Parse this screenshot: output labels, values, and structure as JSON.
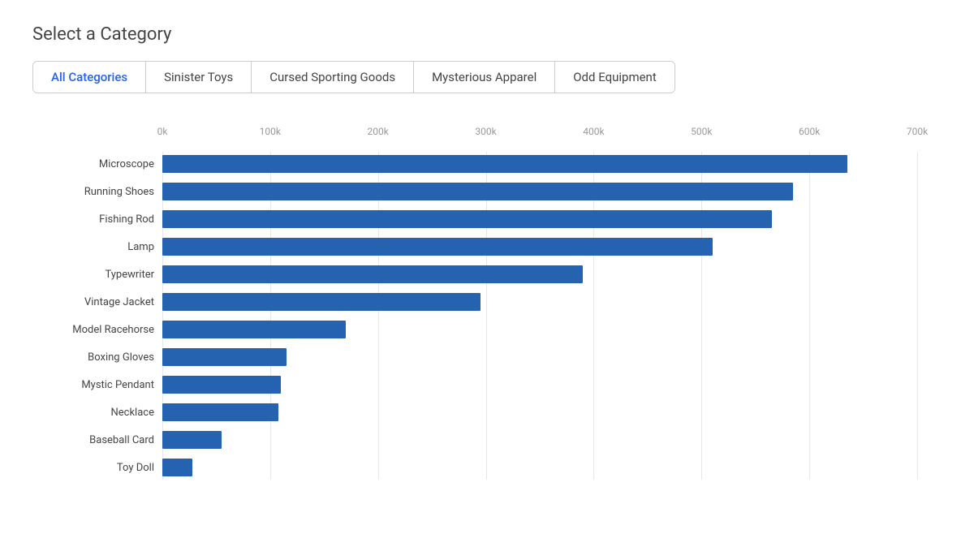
{
  "heading": "Select a Category",
  "tabs": [
    {
      "label": "All Categories",
      "active": true
    },
    {
      "label": "Sinister Toys",
      "active": false
    },
    {
      "label": "Cursed Sporting Goods",
      "active": false
    },
    {
      "label": "Mysterious Apparel",
      "active": false
    },
    {
      "label": "Odd Equipment",
      "active": false
    }
  ],
  "xAxis": {
    "labels": [
      "0k",
      "100k",
      "200k",
      "300k",
      "400k",
      "500k",
      "600k",
      "700k"
    ],
    "max": 700000
  },
  "bars": [
    {
      "label": "Microscope",
      "value": 635000
    },
    {
      "label": "Running Shoes",
      "value": 585000
    },
    {
      "label": "Fishing Rod",
      "value": 565000
    },
    {
      "label": "Lamp",
      "value": 510000
    },
    {
      "label": "Typewriter",
      "value": 390000
    },
    {
      "label": "Vintage Jacket",
      "value": 295000
    },
    {
      "label": "Model Racehorse",
      "value": 170000
    },
    {
      "label": "Boxing Gloves",
      "value": 115000
    },
    {
      "label": "Mystic Pendant",
      "value": 110000
    },
    {
      "label": "Necklace",
      "value": 108000
    },
    {
      "label": "Baseball Card",
      "value": 55000
    },
    {
      "label": "Toy Doll",
      "value": 28000
    }
  ],
  "chartWidth": 930,
  "barColor": "#2563b0"
}
